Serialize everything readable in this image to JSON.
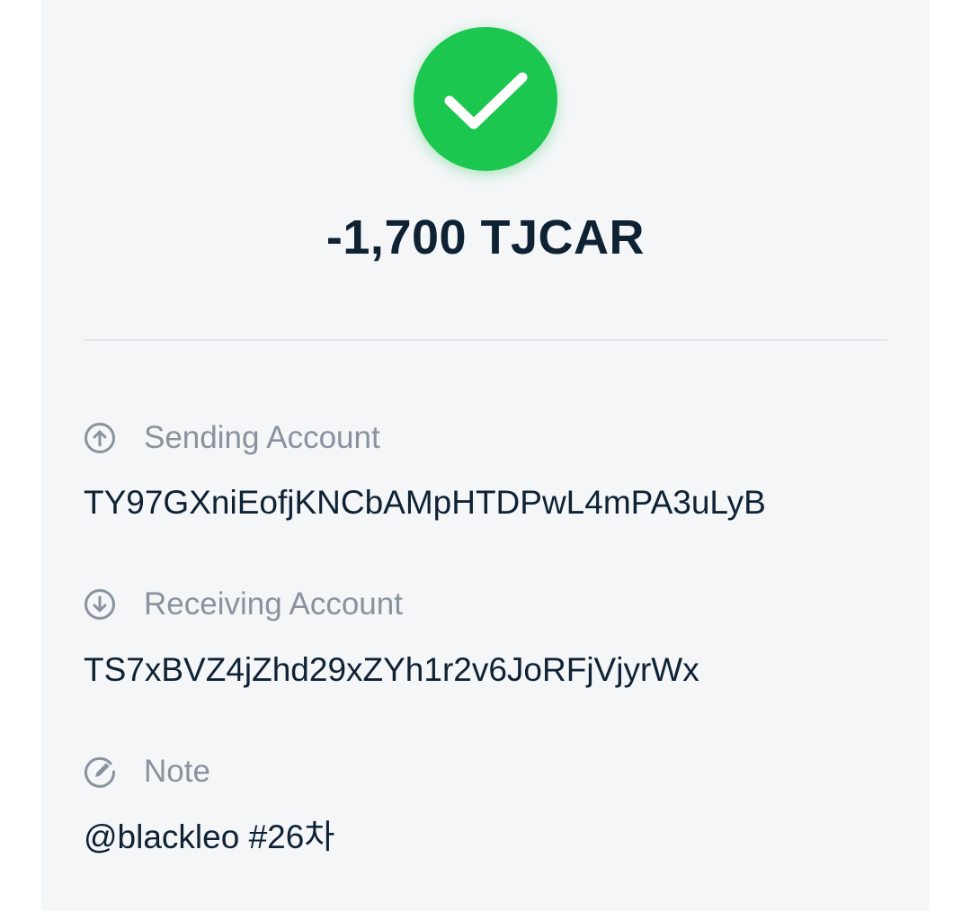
{
  "status": {
    "icon": "checkmark-icon",
    "color": "#1cc74f"
  },
  "amount": "-1,700 TJCAR",
  "fields": {
    "sending": {
      "icon": "arrow-up-circle-icon",
      "label": "Sending Account",
      "value": "TY97GXniEofjKNCbAMpHTDPwL4mPA3uLyB"
    },
    "receiving": {
      "icon": "arrow-down-circle-icon",
      "label": "Receiving Account",
      "value": "TS7xBVZ4jZhd29xZYh1r2v6JoRFjVjyrWx"
    },
    "note": {
      "icon": "edit-circle-icon",
      "label": "Note",
      "value": "@blackleo #26차"
    }
  },
  "colors": {
    "text_primary": "#0f2234",
    "text_secondary": "#8a939d",
    "card_background": "#f4f6f8"
  }
}
